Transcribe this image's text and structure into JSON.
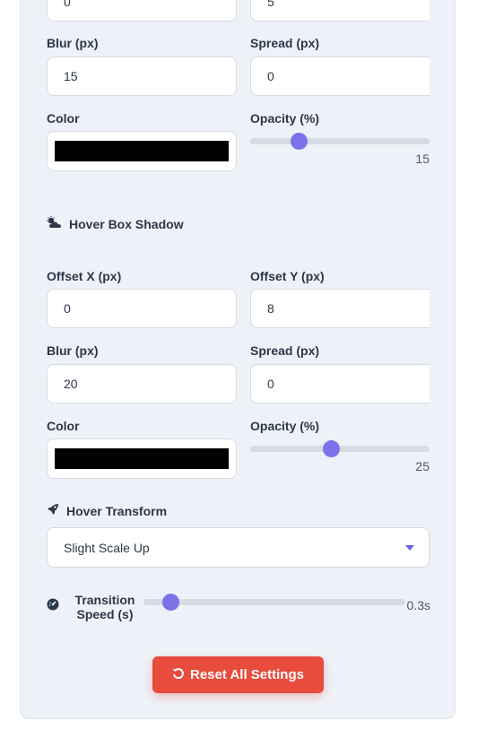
{
  "box_shadow_top": {
    "offset_x_value": "0",
    "offset_y_value": "5",
    "blur_label": "Blur (px)",
    "blur_value": "15",
    "spread_label": "Spread (px)",
    "spread_value": "0",
    "color_label": "Color",
    "color_value": "#000000",
    "opacity_label": "Opacity (%)",
    "opacity_value": "15",
    "opacity_fraction": 0.15
  },
  "hover_box_shadow": {
    "title": "Hover Box Shadow",
    "icon": "cloud-sun-icon",
    "offset_x_label": "Offset X (px)",
    "offset_x_value": "0",
    "offset_y_label": "Offset Y (px)",
    "offset_y_value": "8",
    "blur_label": "Blur (px)",
    "blur_value": "20",
    "spread_label": "Spread (px)",
    "spread_value": "0",
    "color_label": "Color",
    "color_value": "#000000",
    "opacity_label": "Opacity (%)",
    "opacity_value": "25",
    "opacity_fraction": 0.25
  },
  "hover_transform": {
    "title": "Hover Transform",
    "icon": "rocket-icon",
    "selected": "Slight Scale Up"
  },
  "transition": {
    "label_line1": "Transition",
    "label_line2": "Speed (s)",
    "icon": "gauge-icon",
    "value": "0.3s",
    "value_num": 0.3
  },
  "reset_button": {
    "label": "Reset All Settings",
    "icon": "undo-icon",
    "color": "#e74c3c"
  },
  "accent": "#7a73ea"
}
